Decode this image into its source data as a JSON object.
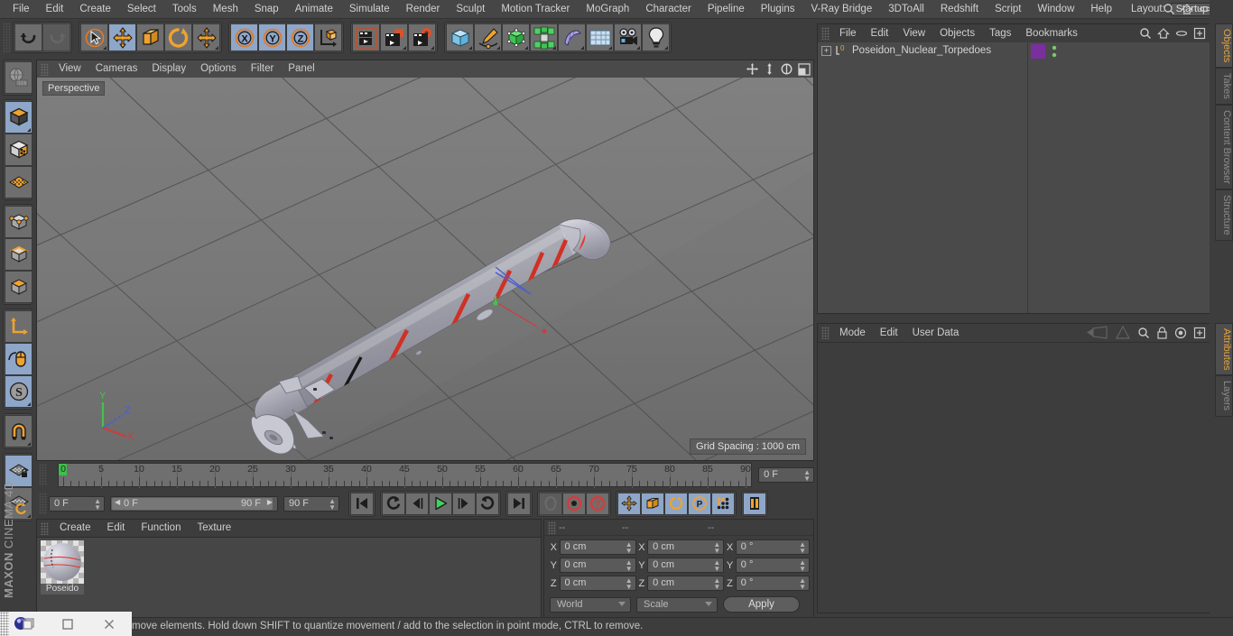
{
  "app": {
    "title": "MAXON CINEMA 4D",
    "brand_line1": "MAXON",
    "brand_line2": "CINEMA 4D"
  },
  "menubar": {
    "items": [
      {
        "label": "File"
      },
      {
        "label": "Edit"
      },
      {
        "label": "Create"
      },
      {
        "label": "Select"
      },
      {
        "label": "Tools"
      },
      {
        "label": "Mesh"
      },
      {
        "label": "Snap"
      },
      {
        "label": "Animate"
      },
      {
        "label": "Simulate"
      },
      {
        "label": "Render"
      },
      {
        "label": "Sculpt"
      },
      {
        "label": "Motion Tracker"
      },
      {
        "label": "MoGraph"
      },
      {
        "label": "Character"
      },
      {
        "label": "Pipeline"
      },
      {
        "label": "Plugins"
      },
      {
        "label": "V-Ray Bridge"
      },
      {
        "label": "3DToAll"
      },
      {
        "label": "Redshift"
      },
      {
        "label": "Script"
      },
      {
        "label": "Window"
      },
      {
        "label": "Help"
      }
    ],
    "layout_label": "Layout:",
    "layout_value": "Startup"
  },
  "toolbar": {
    "undo": "undo-arrow",
    "redo": "redo-arrow",
    "live_selection": "Live Selection",
    "move": "Move",
    "scale": "Scale",
    "rotate": "Rotate",
    "move_dup": "Move Duplicate",
    "axis_x": "X",
    "axis_y": "Y",
    "axis_z": "Z",
    "world_axis": "World/Object Axis",
    "render_view": "Render View",
    "render_region": "Render to Picture Viewer",
    "render_settings": "Render Settings",
    "cube": "Cube primitive",
    "pen": "Spline Pen",
    "subdiv": "Subdivision Surface",
    "mograph": "MoGraph Cloner",
    "deformer": "Bend Deformer",
    "ground": "Floor/Environment",
    "camera": "Camera",
    "light": "Light"
  },
  "lefttool": {
    "items": [
      {
        "name": "make-editable-icon",
        "selected": false
      },
      {
        "name": "model-mode-icon",
        "selected": true
      },
      {
        "name": "texture-mode-icon",
        "selected": false
      },
      {
        "name": "uv-mesh-icon",
        "selected": false
      },
      {
        "name": "points-mode-icon",
        "selected": false
      },
      {
        "name": "edges-mode-icon",
        "selected": false
      },
      {
        "name": "polygons-mode-icon",
        "selected": false
      },
      {
        "name": "axis-modify-icon",
        "selected": false
      },
      {
        "name": "viewport-solo-icon",
        "selected": true
      },
      {
        "name": "enable-snap-icon",
        "selected": true
      },
      {
        "name": "magnet-icon",
        "selected": false
      },
      {
        "name": "workplane-lock-icon",
        "selected": true
      },
      {
        "name": "workplane-rotate-icon",
        "selected": false
      }
    ]
  },
  "viewport": {
    "menu": [
      {
        "label": "View"
      },
      {
        "label": "Cameras"
      },
      {
        "label": "Display"
      },
      {
        "label": "Options"
      },
      {
        "label": "Filter"
      },
      {
        "label": "Panel"
      }
    ],
    "view_label": "Perspective",
    "grid_spacing": "Grid Spacing : 1000 cm",
    "axis_x_label": "X",
    "axis_y_label": "Y",
    "axis_z_label": "Z",
    "axis_x_color": "#d03b3b",
    "axis_y_color": "#45c24a",
    "axis_z_color": "#4a5fd0",
    "model_name": "Poseidon Nuclear Torpedo",
    "body_color": "#b0b0bb",
    "stripe_color": "#e8372a",
    "band_color": "#1a1a1a"
  },
  "timeline": {
    "ticks": [
      "0",
      "5",
      "10",
      "15",
      "20",
      "25",
      "30",
      "35",
      "40",
      "45",
      "50",
      "55",
      "60",
      "65",
      "70",
      "75",
      "80",
      "85",
      "90"
    ],
    "current_frame_field": "0 F",
    "start_field": "0 F",
    "slider_left": "0 F",
    "slider_right": "90 F",
    "end_field": "90 F"
  },
  "transport": {
    "go_start": "go-to-start",
    "prev_key": "previous-key",
    "prev_frame": "previous-frame",
    "play": "play",
    "next_frame": "next-frame",
    "next_key": "next-key",
    "go_end": "go-to-end",
    "record_active": "record-active-objects",
    "autokey": "autokeying",
    "keyframe_select": "keyframe-selection",
    "pos": "record-position",
    "scale": "record-scale",
    "rot": "record-rotation",
    "param": "record-parameter",
    "pla": "point-level-animation",
    "timeline_toggle": "timeline-toggle"
  },
  "material_manager": {
    "menu": [
      {
        "label": "Create"
      },
      {
        "label": "Edit"
      },
      {
        "label": "Function"
      },
      {
        "label": "Texture"
      }
    ],
    "materials": [
      {
        "name": "Poseido"
      }
    ]
  },
  "coordinates": {
    "header": [
      "--",
      "--",
      "--"
    ],
    "rows": [
      {
        "axis": "X",
        "position": "0 cm",
        "size": "0 cm",
        "rotation": "0 °"
      },
      {
        "axis": "Y",
        "position": "0 cm",
        "size": "0 cm",
        "rotation": "0 °"
      },
      {
        "axis": "Z",
        "position": "0 cm",
        "size": "0 cm",
        "rotation": "0 °"
      }
    ],
    "space_dropdown": "World",
    "mode_dropdown": "Scale",
    "apply_label": "Apply"
  },
  "object_manager": {
    "menu": [
      {
        "label": "File"
      },
      {
        "label": "Edit"
      },
      {
        "label": "View"
      },
      {
        "label": "Objects"
      },
      {
        "label": "Tags"
      },
      {
        "label": "Bookmarks"
      }
    ],
    "icons": [
      "search-icon",
      "home-icon",
      "ellipse-icon",
      "add-layer-icon"
    ],
    "objects": [
      {
        "name": "Poseidon_Nuclear_Torpedoes",
        "expanded": false,
        "tag_color": "#7a2f9e"
      }
    ]
  },
  "attribute_manager": {
    "menu": [
      {
        "label": "Mode"
      },
      {
        "label": "Edit"
      },
      {
        "label": "User Data"
      }
    ],
    "icons": [
      "nav-back-icon",
      "nav-up-icon",
      "search-icon",
      "lock-icon",
      "target-icon",
      "add-icon"
    ]
  },
  "vtabs_top": [
    {
      "label": "Objects",
      "active": true
    },
    {
      "label": "Takes",
      "active": false
    },
    {
      "label": "Content Browser",
      "active": false
    },
    {
      "label": "Structure",
      "active": false
    }
  ],
  "vtabs_bottom": [
    {
      "label": "Attributes",
      "active": true
    },
    {
      "label": "Layers",
      "active": false
    }
  ],
  "statusbar": {
    "message": "move elements. Hold down SHIFT to quantize movement / add to the selection in point mode, CTRL to remove."
  },
  "taskbar": {
    "app_icon": "cinema4d-icon",
    "restore_icon": "restore-window-icon",
    "minimize_icon": "minimize-window-icon",
    "close_icon": "close-window-icon"
  }
}
